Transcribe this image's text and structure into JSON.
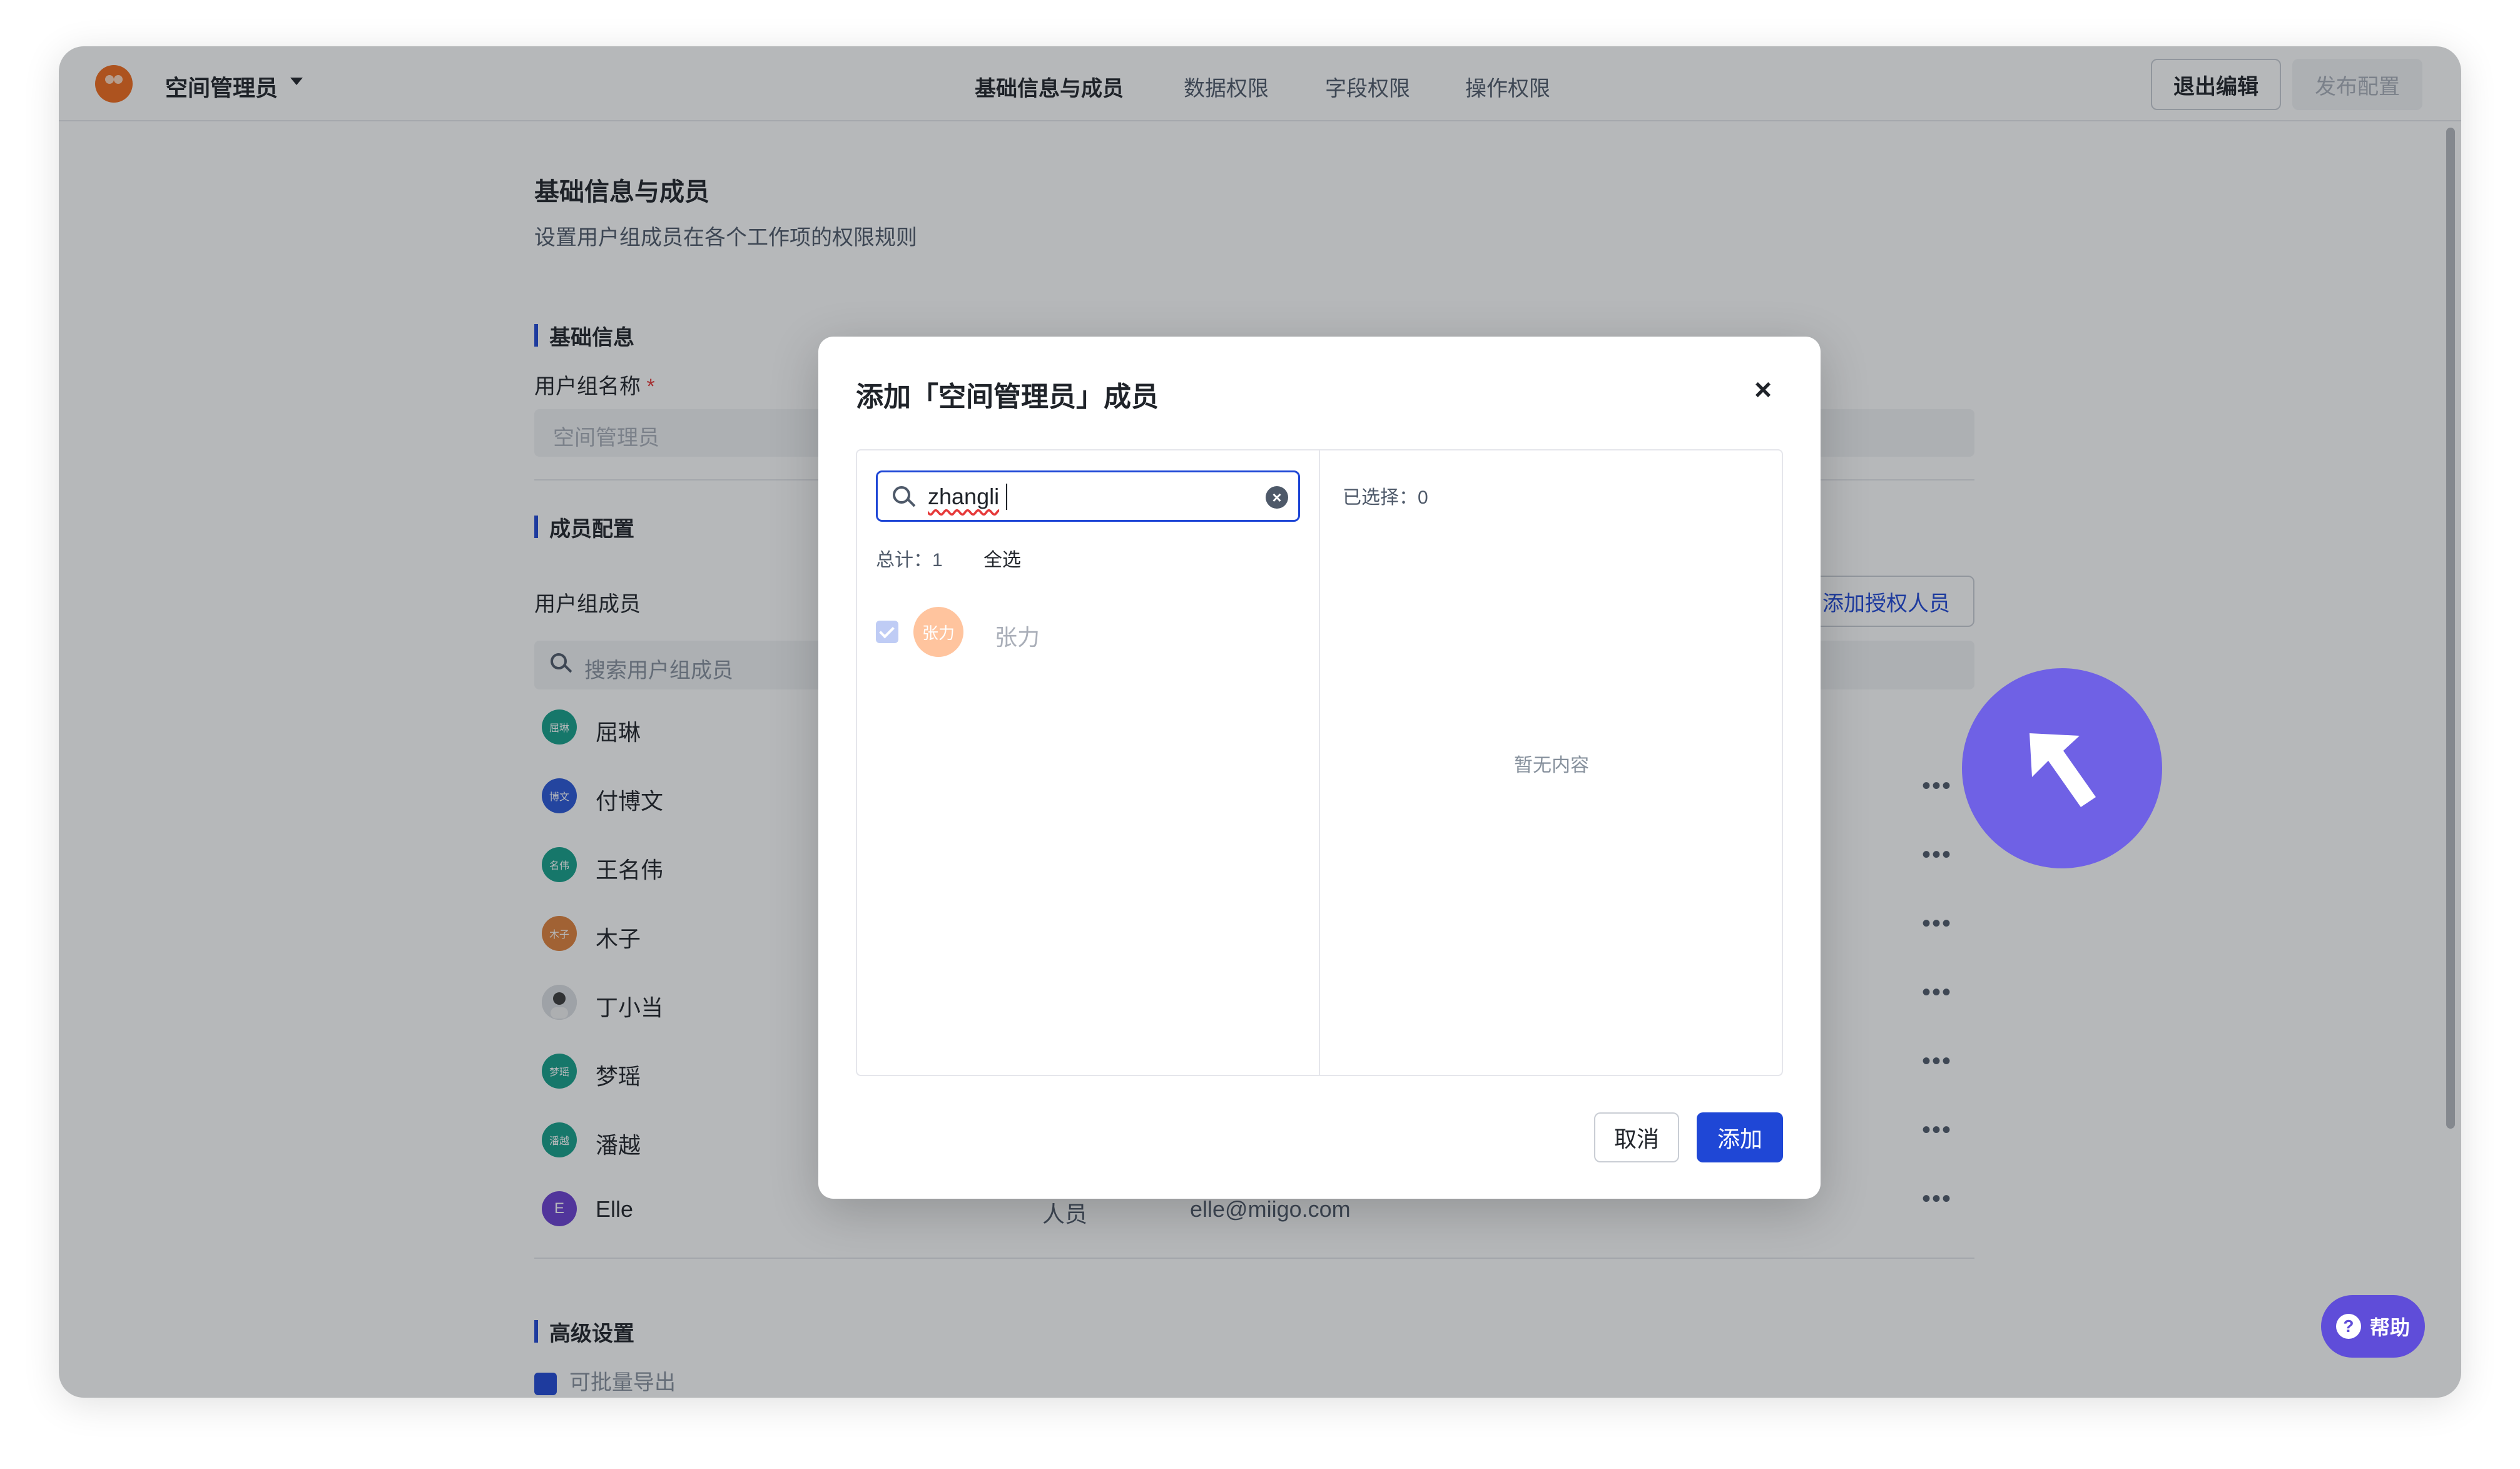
{
  "topbar": {
    "space_name": "空间管理员",
    "tabs": [
      "基础信息与成员",
      "数据权限",
      "字段权限",
      "操作权限"
    ],
    "exit_edit": "退出编辑",
    "publish": "发布配置"
  },
  "page": {
    "title": "基础信息与成员",
    "subtitle": "设置用户组成员在各个工作项的权限规则",
    "basic_section": "基础信息",
    "group_name_label": "用户组名称",
    "required_mark": "*",
    "group_name_placeholder": "空间管理员",
    "member_section": "成员配置",
    "members_label": "用户组成员",
    "add_auth_button": "添加授权人员",
    "search_placeholder": "搜索用户组成员",
    "members": [
      {
        "name": "屈琳",
        "avatar": "屈琳",
        "color": "#14a08a"
      },
      {
        "name": "付博文",
        "avatar": "博文",
        "color": "#2856d8"
      },
      {
        "name": "王名伟",
        "avatar": "名伟",
        "color": "#14a08a"
      },
      {
        "name": "木子",
        "avatar": "木子",
        "color": "#e0803a"
      },
      {
        "name": "丁小当",
        "avatar": "",
        "color": "#d9d9d9"
      },
      {
        "name": "梦瑶",
        "avatar": "梦瑶",
        "color": "#14a08a"
      },
      {
        "name": "潘越",
        "avatar": "潘越",
        "color": "#14a08a"
      },
      {
        "name": "Elle",
        "avatar": "E",
        "color": "#6b3fd1",
        "role": "人员",
        "email": "elle@miigo.com"
      }
    ],
    "more_icon": "•••",
    "advanced_section": "高级设置",
    "batch_export": "可批量导出",
    "help": "帮助",
    "help_icon": "?"
  },
  "modal": {
    "title": "添加「空间管理员」成员",
    "close_icon": "×",
    "search_value": "zhangli",
    "clear_icon": "×",
    "total": "总计：1",
    "select_all": "全选",
    "candidate": {
      "name": "张力",
      "avatar": "张力"
    },
    "selected": "已选择：0",
    "empty": "暂无内容",
    "cancel": "取消",
    "add": "添加"
  },
  "colors": {
    "accent": "#1f47d6",
    "cursor_highlight": "#6c5ce7",
    "help_button": "#5f4dd9"
  }
}
